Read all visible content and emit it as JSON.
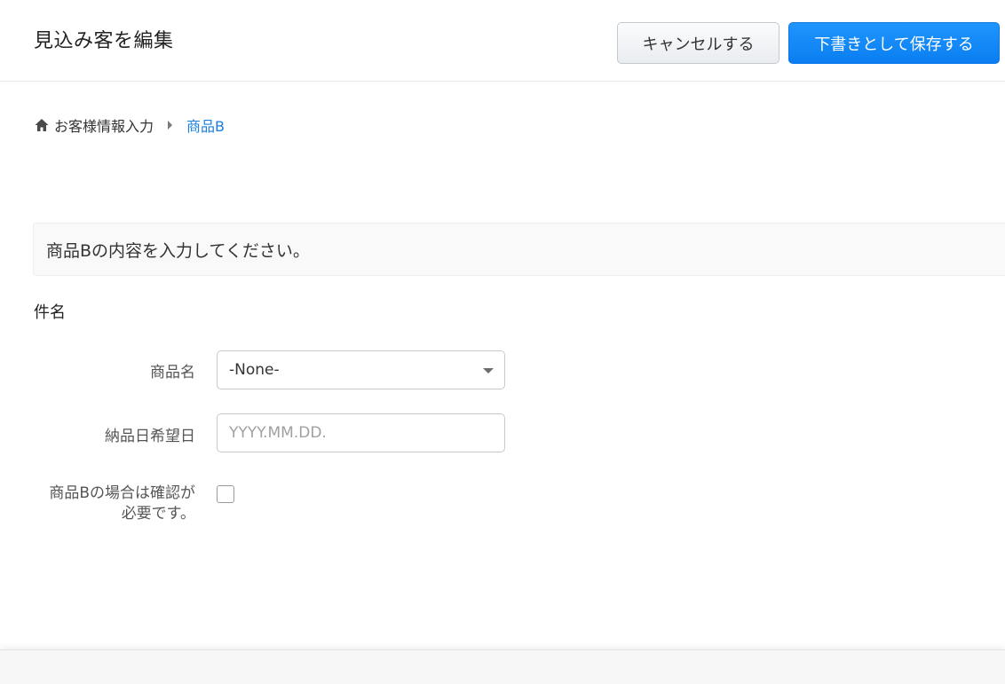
{
  "header": {
    "title": "見込み客を編集",
    "cancel_label": "キャンセルする",
    "save_draft_label": "下書きとして保存する"
  },
  "breadcrumb": {
    "home_label": "お客様情報入力",
    "current_label": "商品B"
  },
  "info_message": "商品Bの内容を入力してください。",
  "section": {
    "title": "件名"
  },
  "fields": {
    "product_name": {
      "label": "商品名",
      "value": "-None-"
    },
    "delivery_date": {
      "label": "納品日希望日",
      "value": "",
      "placeholder": "YYYY.MM.DD."
    },
    "confirm": {
      "label_line1": "商品Bの場合は確認が",
      "label_line2": "必要です。",
      "checked": false
    }
  },
  "colors": {
    "accent": "#0a7ef0",
    "link": "#1b7fe0"
  },
  "icons": {
    "home": "home-icon",
    "breadcrumb_separator": "caret-right-icon",
    "select_caret": "caret-down-icon"
  }
}
